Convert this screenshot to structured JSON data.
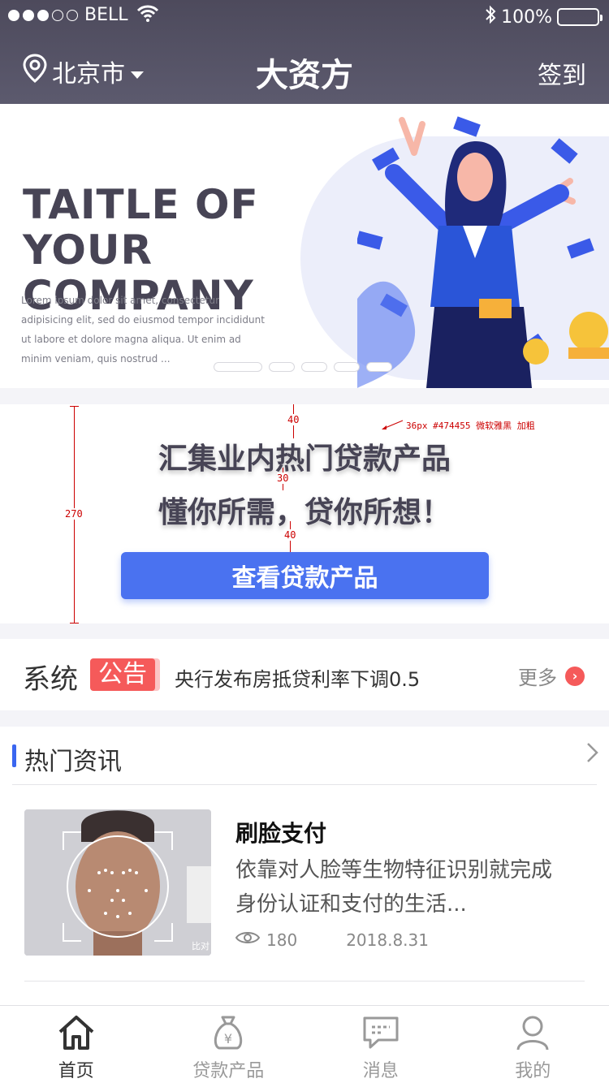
{
  "status_bar": {
    "carrier": "BELL",
    "battery": "100%"
  },
  "nav": {
    "city": "北京市",
    "title": "大资方",
    "checkin": "签到"
  },
  "banner": {
    "headline": "TAITLE OF YOUR COMPANY",
    "body": "Lorem ipsum dolor sit amet, consectetur adipisicing elit, sed do eiusmod tempor incididunt ut labore et dolore magna aliqua. Ut enim ad minim veniam, quis nostrud ...",
    "slide_count": 5,
    "active_slide": 1
  },
  "promo": {
    "line1": "汇集业内热门贷款产品",
    "line2": "懂你所需，贷你所想！",
    "button": "查看贷款产品",
    "annotations": {
      "spacing_top": "40",
      "spacing_mid": "30",
      "spacing_bottom": "40",
      "height": "270",
      "font_note": "36px #474455 微软雅黑 加粗"
    }
  },
  "notice": {
    "label": "系统",
    "badge": "公告",
    "text": "央行发布房抵贷利率下调0.5",
    "more": "更多"
  },
  "news": {
    "section_title": "热门资讯",
    "items": [
      {
        "title": "刷脸支付",
        "desc": "依靠对人脸等生物特征识别就完成身份认证和支付的生活...",
        "views": "180",
        "date": "2018.8.31",
        "thumb_caption": "比对"
      }
    ]
  },
  "tabs": [
    {
      "label": "首页",
      "icon": "home-icon",
      "active": true
    },
    {
      "label": "贷款产品",
      "icon": "money-bag-icon",
      "active": false
    },
    {
      "label": "消息",
      "icon": "message-icon",
      "active": false
    },
    {
      "label": "我的",
      "icon": "user-icon",
      "active": false
    }
  ],
  "colors": {
    "header": "#4d4a5c",
    "primary": "#4a72f0",
    "accent": "#f55a5a",
    "text": "#474455"
  }
}
